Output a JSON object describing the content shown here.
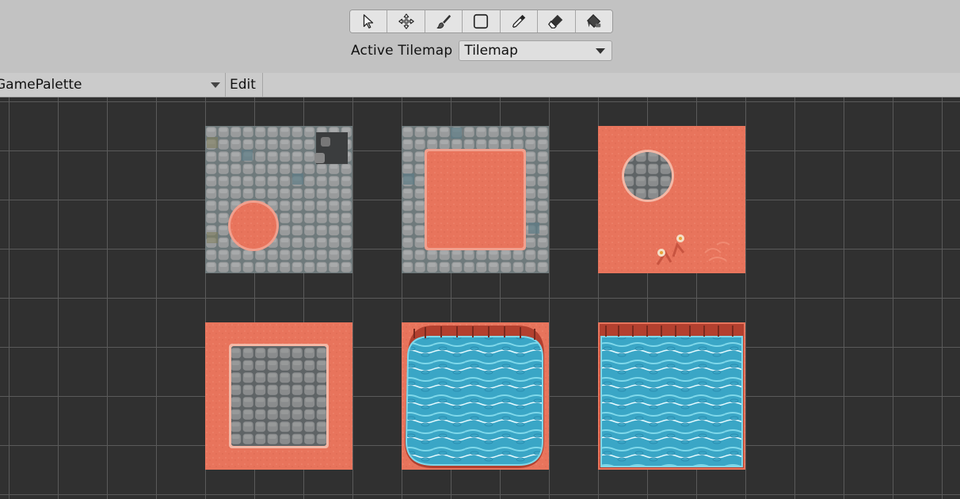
{
  "toolbar": {
    "tools": [
      {
        "name": "select-tool",
        "icon": "arrow-cursor-icon"
      },
      {
        "name": "move-tool",
        "icon": "move-arrows-icon"
      },
      {
        "name": "paint-tool",
        "icon": "brush-icon"
      },
      {
        "name": "box-fill-tool",
        "icon": "rectangle-icon"
      },
      {
        "name": "picker-tool",
        "icon": "eyedropper-icon"
      },
      {
        "name": "erase-tool",
        "icon": "eraser-icon"
      },
      {
        "name": "fill-tool",
        "icon": "paint-bucket-icon"
      }
    ],
    "active_tilemap_label": "Active Tilemap",
    "active_tilemap_value": "Tilemap"
  },
  "palette": {
    "name": "GamePalette",
    "edit_label": "Edit"
  },
  "tiles": [
    {
      "name": "tile-stone-sand-circle"
    },
    {
      "name": "tile-stone-sand-square"
    },
    {
      "name": "tile-sand-stone-hole"
    },
    {
      "name": "tile-sand-stone-square"
    },
    {
      "name": "tile-water-rounded"
    },
    {
      "name": "tile-water-square"
    }
  ],
  "colors": {
    "sand": "#e8765f",
    "stone": "#8a8d8f",
    "water": "#36a9c9",
    "grid_bg": "#303030",
    "grid_line": "#5a5a5a"
  }
}
